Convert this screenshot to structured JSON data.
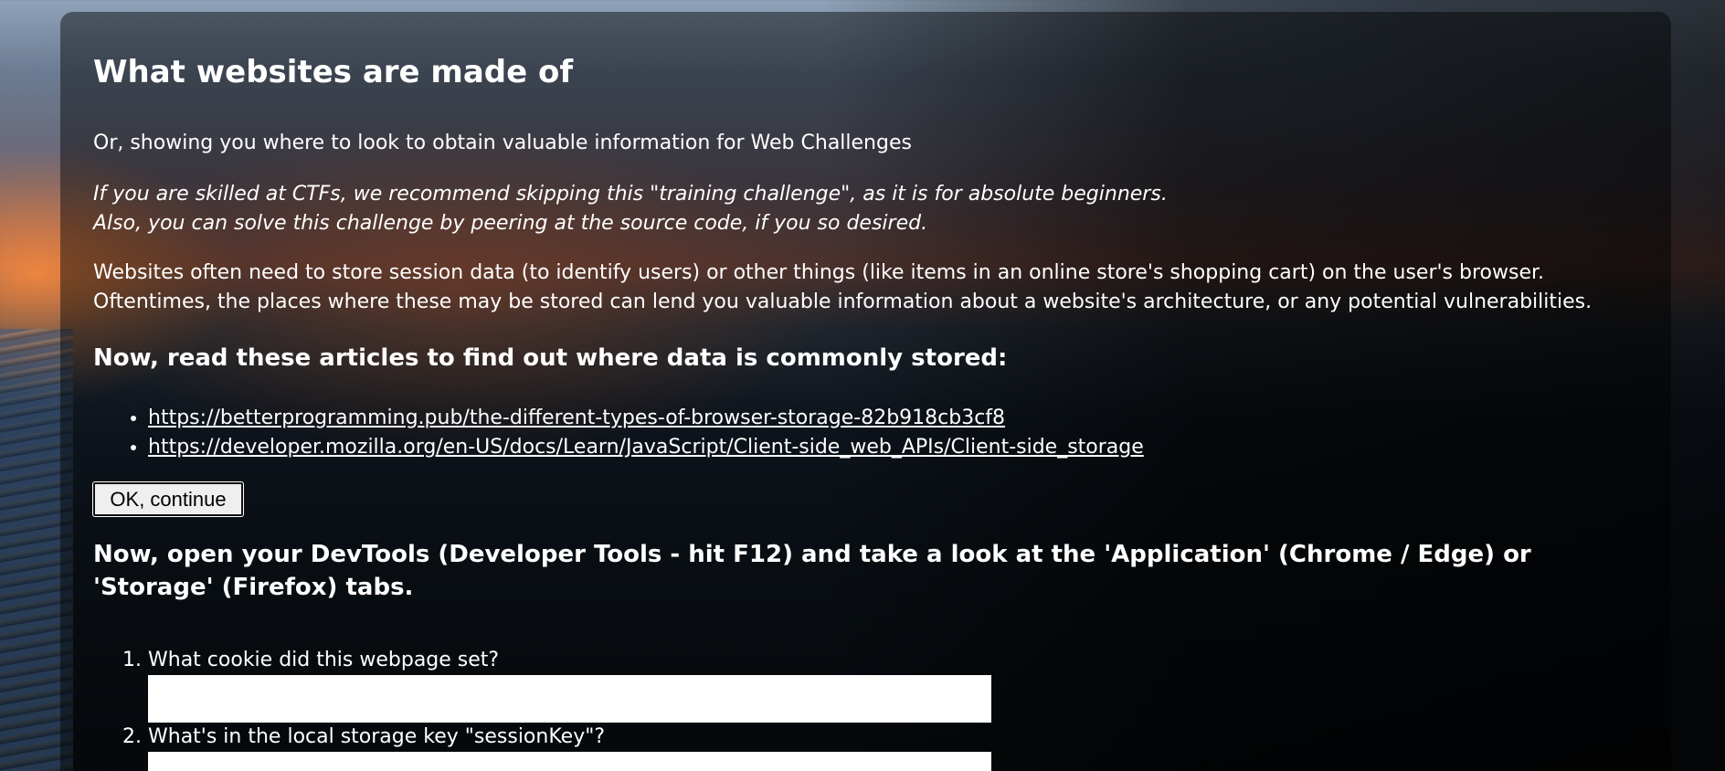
{
  "page": {
    "title": "What websites are made of",
    "subtitle": "Or, showing you where to look to obtain valuable information for Web Challenges",
    "note_line1": "If you are skilled at CTFs, we recommend skipping this \"training challenge\", as it is for absolute beginners.",
    "note_line2": "Also, you can solve this challenge by peering at the source code, if you so desired.",
    "intro_line1": "Websites often need to store session data (to identify users) or other things (like items in an online store's shopping cart) on the user's browser.",
    "intro_line2": "Oftentimes, the places where these may be stored can lend you valuable information about a website's architecture, or any potential vulnerabilities."
  },
  "articles": {
    "heading": "Now, read these articles to find out where data is commonly stored:",
    "links": [
      "https://betterprogramming.pub/the-different-types-of-browser-storage-82b918cb3cf8",
      "https://developer.mozilla.org/en-US/docs/Learn/JavaScript/Client-side_web_APIs/Client-side_storage"
    ],
    "continue_label": "OK, continue"
  },
  "devtools": {
    "heading": "Now, open your DevTools (Developer Tools - hit F12) and take a look at the 'Application' (Chrome / Edge) or 'Storage' (Firefox) tabs.",
    "questions": [
      {
        "label": "What cookie did this webpage set?",
        "value": ""
      },
      {
        "label": "What's in the local storage key \"sessionKey\"?",
        "value": ""
      }
    ]
  },
  "colors": {
    "panel_overlay": "rgba(0,0,0,0.45)",
    "text": "#ffffff",
    "button_bg": "#efefef"
  }
}
